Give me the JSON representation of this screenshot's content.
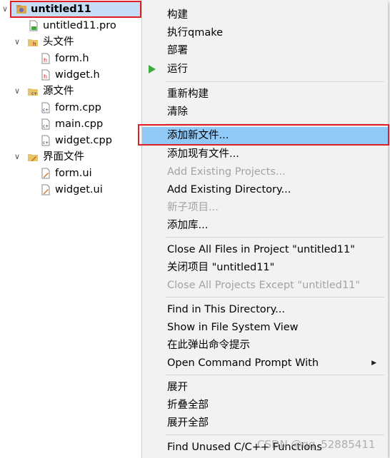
{
  "tree": {
    "project": {
      "name": "untitled11",
      "icon": "qt-project-icon",
      "expanded": true
    },
    "pro_file": {
      "name": "untitled11.pro",
      "icon": "pro-file-icon"
    },
    "headers": {
      "label": "头文件",
      "icon": "header-folder-icon",
      "expanded": true,
      "items": [
        {
          "name": "form.h",
          "icon": "h-file-icon"
        },
        {
          "name": "widget.h",
          "icon": "h-file-icon"
        }
      ]
    },
    "sources": {
      "label": "源文件",
      "icon": "source-folder-icon",
      "expanded": true,
      "items": [
        {
          "name": "form.cpp",
          "icon": "cpp-file-icon"
        },
        {
          "name": "main.cpp",
          "icon": "cpp-file-icon"
        },
        {
          "name": "widget.cpp",
          "icon": "cpp-file-icon"
        }
      ]
    },
    "forms": {
      "label": "界面文件",
      "icon": "forms-folder-icon",
      "expanded": true,
      "items": [
        {
          "name": "form.ui",
          "icon": "ui-file-icon"
        },
        {
          "name": "widget.ui",
          "icon": "ui-file-icon"
        }
      ]
    }
  },
  "menu": {
    "build": "构建",
    "run_qmake": "执行qmake",
    "deploy": "部署",
    "run": "运行",
    "rebuild": "重新构建",
    "clean": "清除",
    "add_new_file": "添加新文件...",
    "add_existing_files": "添加现有文件...",
    "add_existing_projects": "Add Existing Projects...",
    "add_existing_directory": "Add Existing Directory...",
    "new_subproject": "新子项目...",
    "add_library": "添加库...",
    "close_all_files": "Close All Files in Project \"untitled11\"",
    "close_project": "关闭项目 \"untitled11\"",
    "close_all_except": "Close All Projects Except \"untitled11\"",
    "find_in_directory": "Find in This Directory...",
    "show_in_fs": "Show in File System View",
    "open_cmd_here": "在此弹出命令提示",
    "open_cmd_with": "Open Command Prompt With",
    "expand": "展开",
    "collapse_all": "折叠全部",
    "expand_all": "展开全部",
    "find_unused": "Find Unused C/C++ Functions"
  },
  "watermark": "CSDN @qq_52885411",
  "colors": {
    "highlight": "#91c9f7",
    "selection": "#c5ddf6",
    "annotation_red": "#e01e25",
    "run_green": "#3faa3f"
  }
}
